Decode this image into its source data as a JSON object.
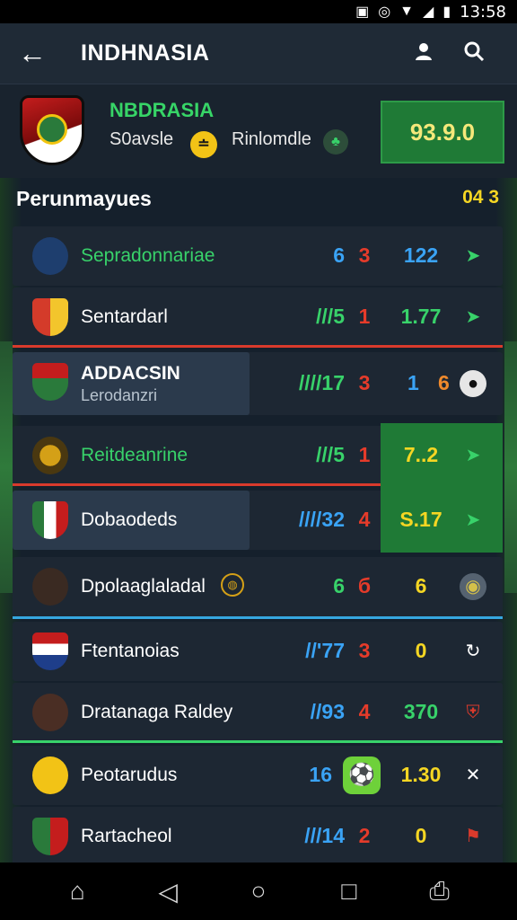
{
  "status_bar": {
    "time": "13:58"
  },
  "app_bar": {
    "title": "INDHNASIA"
  },
  "team": {
    "name": "NBDRASIA",
    "sub1": "S0avsle",
    "coin": "≐",
    "sub2": "Rinlomdle",
    "score": "93.9.0"
  },
  "section": {
    "title": "Perunmayues",
    "meta": "04 3"
  },
  "rows": [
    {
      "name": "Sepradonnariae",
      "stat1": "6",
      "stat2": "3",
      "stat3": "122",
      "icon": "leaf-icon"
    },
    {
      "name": "Sentardarl",
      "stat1": "///5",
      "stat2": "1",
      "stat3": "1.77",
      "icon": "leaf-icon"
    },
    {
      "name": "ADDACSIN",
      "subname": "Lerodanzri",
      "stat1": "////17",
      "stat2": "3",
      "stat3a": "1",
      "stat3b": "6",
      "icon": "ball-icon"
    },
    {
      "name": "Reitdeanrine",
      "stat1": "///5",
      "stat2": "1",
      "stat3": "7..2",
      "icon": "leaf-icon"
    },
    {
      "name": "Dobaodeds",
      "stat1": "////32",
      "stat2": "4",
      "stat3": "S.17",
      "icon": "leaf-icon"
    },
    {
      "name": "Dpolaaglaladal",
      "stat1": "6",
      "stat2": "б",
      "stat3": "6",
      "icon": "badge-icon"
    },
    {
      "name": "Ftentanoias",
      "stat1": "//'77",
      "stat2": "3",
      "stat3": "0",
      "icon": "refresh-icon"
    },
    {
      "name": "Dratanaga Raldey",
      "stat1": "//93",
      "stat2": "4",
      "stat3": "370",
      "icon": "shield-icon"
    },
    {
      "name": "Peotarudus",
      "stat1": "16",
      "stat3": "1.30",
      "icon": "close-icon"
    },
    {
      "name": "Rartacheol",
      "stat1": "///14",
      "stat2": "2",
      "stat3": "0",
      "icon": "flag-icon"
    }
  ]
}
